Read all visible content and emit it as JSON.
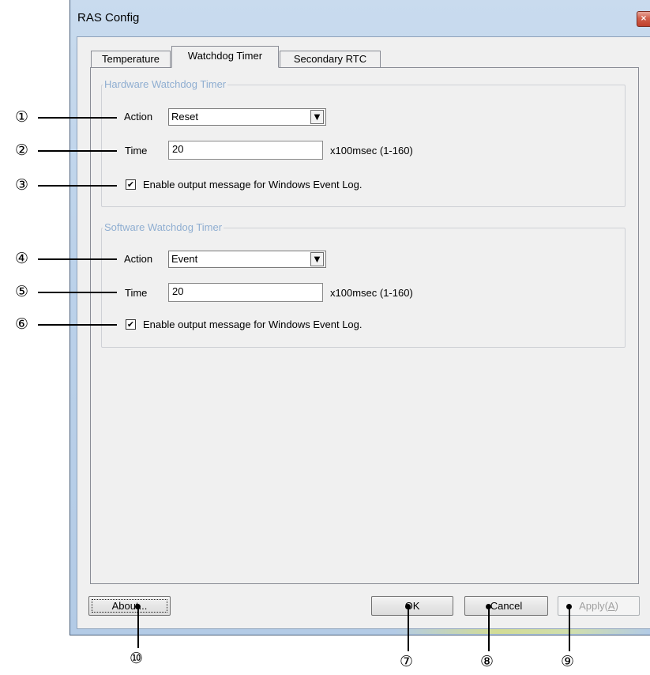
{
  "window": {
    "title": "RAS Config",
    "close_icon": "×"
  },
  "tabs": [
    {
      "label": "Temperature",
      "active": false
    },
    {
      "label": "Watchdog Timer",
      "active": true
    },
    {
      "label": "Secondary RTC",
      "active": false
    }
  ],
  "hardware": {
    "group_label": "Hardware Watchdog Timer",
    "action_label": "Action",
    "action_value": "Reset",
    "time_label": "Time",
    "time_value": "20",
    "time_unit": "x100msec (1-160)",
    "checkbox_checked": true,
    "checkbox_mark": "✔",
    "checkbox_label": "Enable output message for Windows Event Log."
  },
  "software": {
    "group_label": "Software Watchdog Timer",
    "action_label": "Action",
    "action_value": "Event",
    "time_label": "Time",
    "time_value": "20",
    "time_unit": "x100msec (1-160)",
    "checkbox_checked": true,
    "checkbox_mark": "✔",
    "checkbox_label": "Enable output message for Windows Event Log."
  },
  "buttons": {
    "about": "About...",
    "ok": "OK",
    "cancel": "Cancel",
    "apply_prefix": "Apply(",
    "apply_access": "A",
    "apply_suffix": ")"
  },
  "dropdown_arrow": "▼",
  "callouts": {
    "c1": "①",
    "c2": "②",
    "c3": "③",
    "c4": "④",
    "c5": "⑤",
    "c6": "⑥",
    "c7": "⑦",
    "c8": "⑧",
    "c9": "⑨",
    "c10": "⑩"
  }
}
